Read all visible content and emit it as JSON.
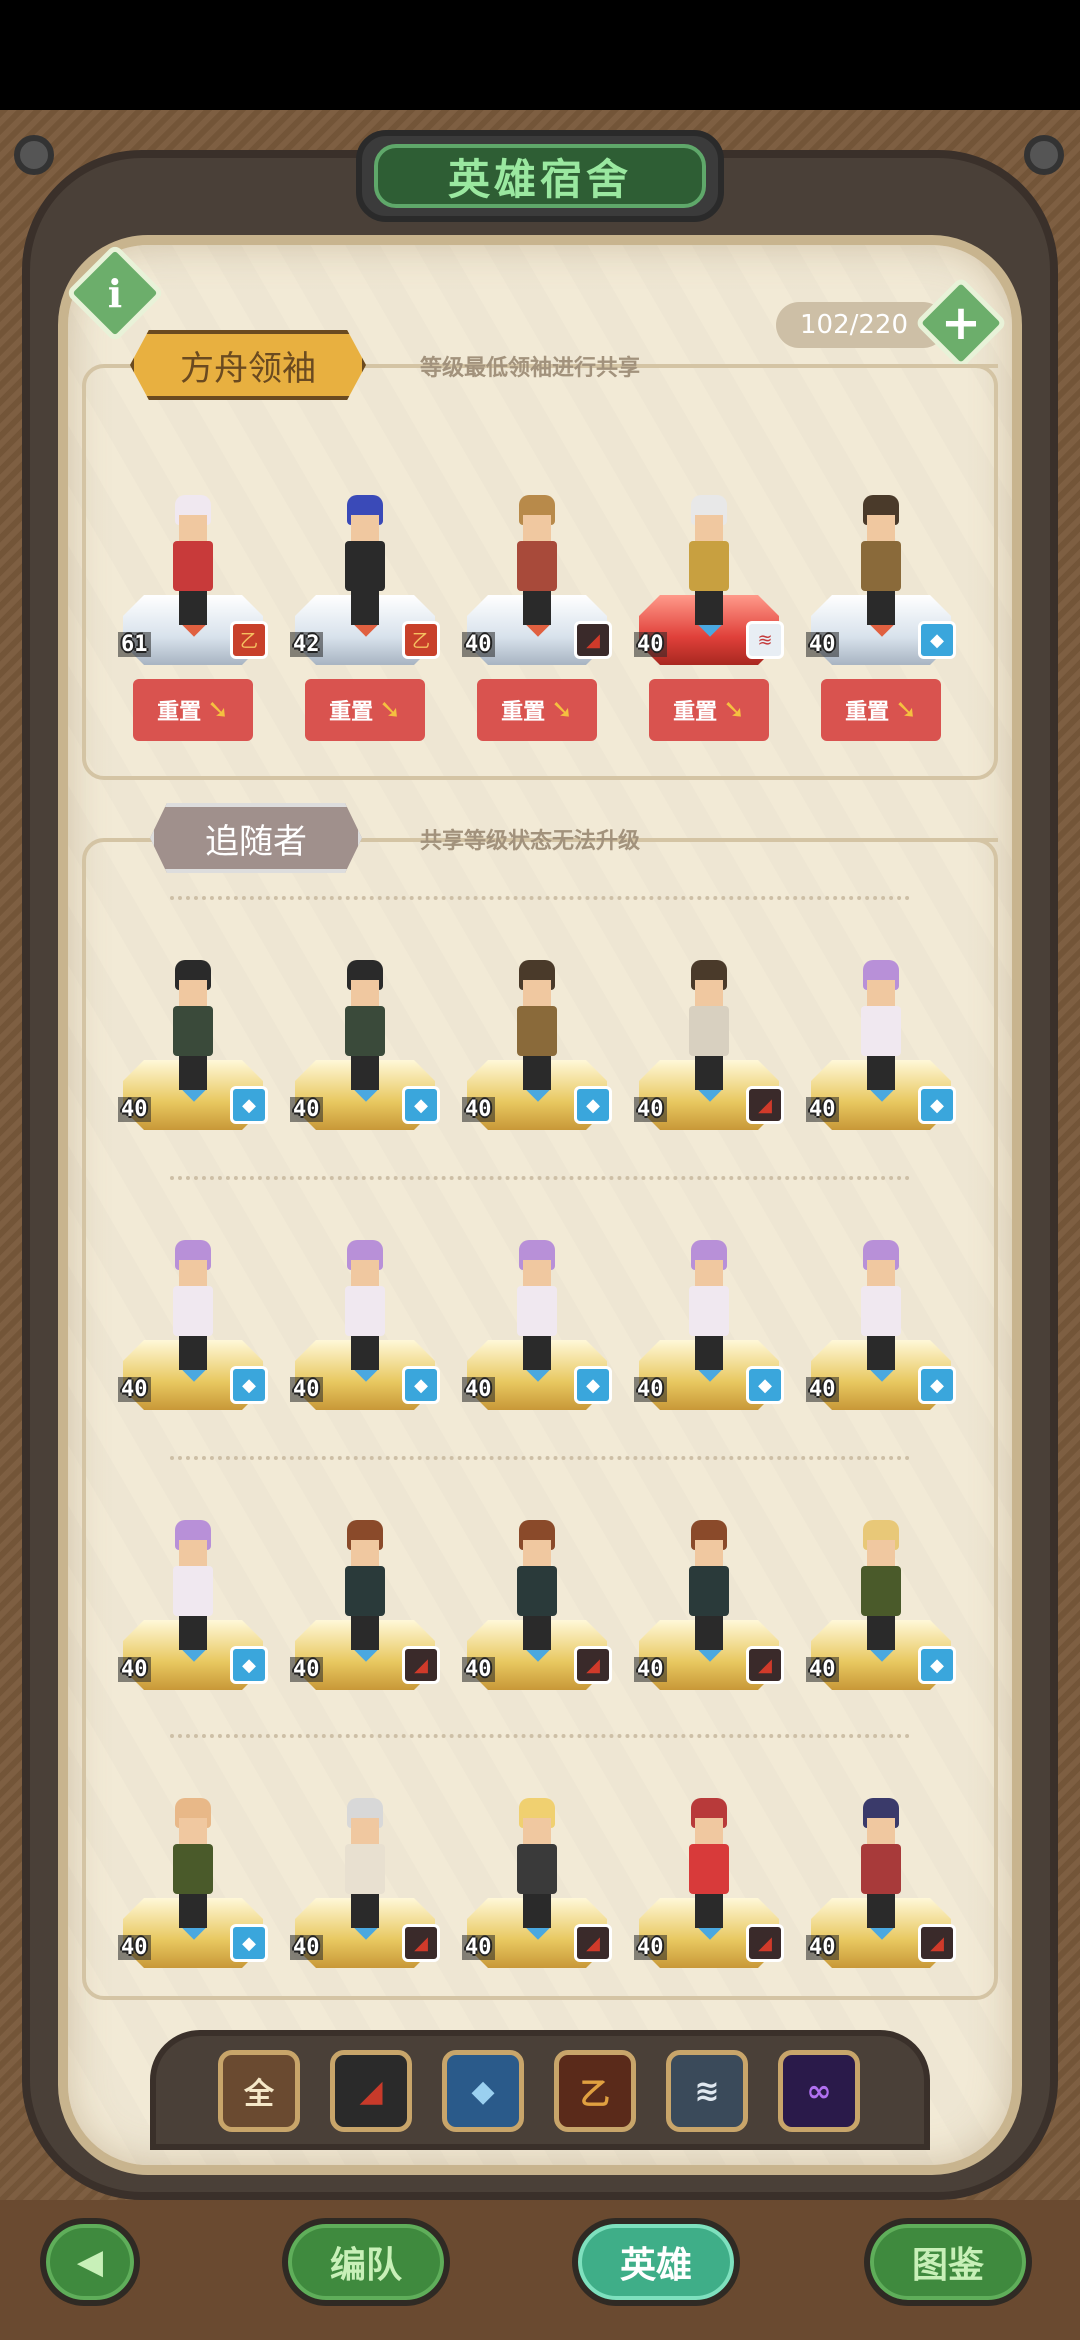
{
  "title": "英雄宿舍",
  "hero_count": "102/220",
  "icons": {
    "info": "i",
    "add": "+",
    "back": "◀"
  },
  "leaders": {
    "title": "方舟领袖",
    "description": "等级最低领袖进行共享",
    "reset_label": "重置",
    "heroes": [
      {
        "level": "61",
        "faction": "dragon",
        "pedestal": "silver",
        "hair": "#f0e8f0",
        "body": "#c83a3a"
      },
      {
        "level": "42",
        "faction": "dragon",
        "pedestal": "silver",
        "hair": "#3a4ab8",
        "body": "#2a2a2a"
      },
      {
        "level": "40",
        "faction": "raider",
        "pedestal": "silver",
        "hair": "#b88a4a",
        "body": "#a84a3a"
      },
      {
        "level": "40",
        "faction": "wing",
        "pedestal": "red",
        "hair": "#e8e8e8",
        "body": "#c8a040"
      },
      {
        "level": "40",
        "faction": "wolf",
        "pedestal": "silver",
        "hair": "#4a3a2a",
        "body": "#8a6a3a"
      }
    ]
  },
  "followers": {
    "title": "追随者",
    "description": "共享等级状态无法升级",
    "rows": [
      [
        {
          "level": "40",
          "faction": "wolf",
          "hair": "#2a2a2a",
          "body": "#3a4a3a"
        },
        {
          "level": "40",
          "faction": "wolf",
          "hair": "#2a2a2a",
          "body": "#3a4a3a"
        },
        {
          "level": "40",
          "faction": "wolf",
          "hair": "#4a3a2a",
          "body": "#8a6a3a"
        },
        {
          "level": "40",
          "faction": "raider",
          "hair": "#4a3a2a",
          "body": "#d8d0c0"
        },
        {
          "level": "40",
          "faction": "wolf",
          "hair": "#b890d8",
          "body": "#f0e8f0"
        }
      ],
      [
        {
          "level": "40",
          "faction": "wolf",
          "hair": "#b890d8",
          "body": "#f0e8f0"
        },
        {
          "level": "40",
          "faction": "wolf",
          "hair": "#b890d8",
          "body": "#f0e8f0"
        },
        {
          "level": "40",
          "faction": "wolf",
          "hair": "#b890d8",
          "body": "#f0e8f0"
        },
        {
          "level": "40",
          "faction": "wolf",
          "hair": "#b890d8",
          "body": "#f0e8f0"
        },
        {
          "level": "40",
          "faction": "wolf",
          "hair": "#b890d8",
          "body": "#f0e8f0"
        }
      ],
      [
        {
          "level": "40",
          "faction": "wolf",
          "hair": "#b890d8",
          "body": "#f0e8f0"
        },
        {
          "level": "40",
          "faction": "raider",
          "hair": "#8a4a2a",
          "body": "#2a3a3a"
        },
        {
          "level": "40",
          "faction": "raider",
          "hair": "#8a4a2a",
          "body": "#2a3a3a"
        },
        {
          "level": "40",
          "faction": "raider",
          "hair": "#8a4a2a",
          "body": "#2a3a3a"
        },
        {
          "level": "40",
          "faction": "wolf",
          "hair": "#e8c878",
          "body": "#4a5a2a"
        }
      ],
      [
        {
          "level": "40",
          "faction": "wolf",
          "hair": "#e8b888",
          "body": "#4a5a2a"
        },
        {
          "level": "40",
          "faction": "raider",
          "hair": "#d8d8d8",
          "body": "#e8e0d0"
        },
        {
          "level": "40",
          "faction": "raider",
          "hair": "#f0d070",
          "body": "#3a3a3a"
        },
        {
          "level": "40",
          "faction": "raider",
          "hair": "#b83a3a",
          "body": "#d83a3a"
        },
        {
          "level": "40",
          "faction": "raider",
          "hair": "#3a3a6a",
          "body": "#a83a3a"
        }
      ]
    ]
  },
  "filters": [
    {
      "name": "all",
      "glyph": "全",
      "bg": "#6a4a30",
      "color": "#f5e8c8"
    },
    {
      "name": "raider",
      "glyph": "◢",
      "bg": "#2a2a2a",
      "color": "#c83a2a"
    },
    {
      "name": "wolf",
      "glyph": "◆",
      "bg": "#2a5a8a",
      "color": "#9ad0f0"
    },
    {
      "name": "dragon",
      "glyph": "乙",
      "bg": "#5a2a1a",
      "color": "#e0a040"
    },
    {
      "name": "wing",
      "glyph": "≋",
      "bg": "#3a4a5a",
      "color": "#e0e8f0"
    },
    {
      "name": "void",
      "glyph": "∞",
      "bg": "#2a1a4a",
      "color": "#b070f0"
    }
  ],
  "nav": {
    "team": "编队",
    "heroes": "英雄",
    "codex": "图鉴"
  }
}
